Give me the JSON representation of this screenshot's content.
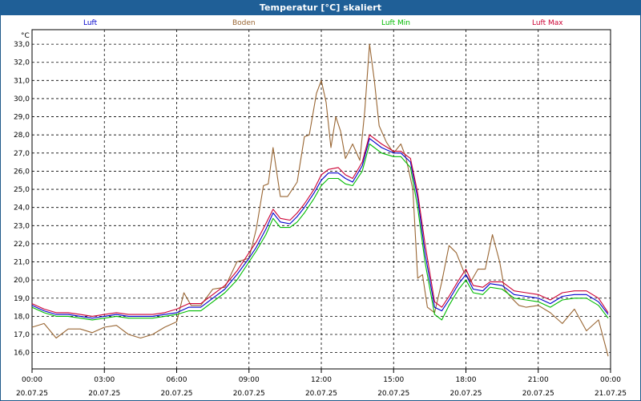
{
  "title": "Temperatur [°C] skaliert",
  "y_unit": "°C",
  "colors": {
    "titlebar": "#1f5f97",
    "Luft": "#0000cc",
    "Boden": "#996633",
    "Luft Min": "#00bb00",
    "Luft Max": "#cc0033"
  },
  "chart_data": {
    "type": "line",
    "title": "Temperatur [°C] skaliert",
    "ylabel": "°C",
    "ylim": [
      15.1,
      33.8
    ],
    "yticks": [
      "16,0",
      "17,0",
      "18,0",
      "19,0",
      "20,0",
      "21,0",
      "22,0",
      "23,0",
      "24,0",
      "25,0",
      "26,0",
      "27,0",
      "28,0",
      "29,0",
      "30,0",
      "31,0",
      "32,0",
      "33,0"
    ],
    "xlim": [
      0,
      24
    ],
    "xticks": [
      {
        "time": "00:00",
        "date": "20.07.25"
      },
      {
        "time": "03:00",
        "date": "20.07.25"
      },
      {
        "time": "06:00",
        "date": "20.07.25"
      },
      {
        "time": "09:00",
        "date": "20.07.25"
      },
      {
        "time": "12:00",
        "date": "20.07.25"
      },
      {
        "time": "15:00",
        "date": "20.07.25"
      },
      {
        "time": "18:00",
        "date": "20.07.25"
      },
      {
        "time": "21:00",
        "date": "20.07.25"
      },
      {
        "time": "00:00",
        "date": "21.07.25"
      }
    ],
    "grid": true,
    "legend": "top",
    "series": [
      {
        "name": "Luft",
        "x": [
          0,
          0.5,
          1,
          1.5,
          2,
          2.5,
          3,
          3.5,
          4,
          4.5,
          5,
          5.5,
          6,
          6.5,
          7,
          7.5,
          8,
          8.5,
          9,
          9.3,
          9.7,
          10,
          10.3,
          10.7,
          11,
          11.3,
          11.7,
          12,
          12.3,
          12.7,
          13,
          13.3,
          13.7,
          14,
          14.5,
          15,
          15.3,
          15.7,
          16,
          16.3,
          16.7,
          17,
          17.3,
          17.7,
          18,
          18.3,
          18.7,
          19,
          19.5,
          20,
          20.5,
          21,
          21.5,
          22,
          22.5,
          23,
          23.5,
          23.9
        ],
        "y": [
          18.6,
          18.3,
          18.1,
          18.1,
          18.0,
          17.9,
          18.0,
          18.1,
          18.0,
          18.0,
          18.0,
          18.1,
          18.2,
          18.5,
          18.5,
          19.0,
          19.5,
          20.3,
          21.2,
          21.8,
          22.8,
          23.7,
          23.2,
          23.1,
          23.5,
          24.0,
          24.8,
          25.5,
          25.9,
          25.9,
          25.6,
          25.4,
          26.3,
          27.8,
          27.3,
          27.0,
          27.0,
          26.5,
          24.5,
          21.5,
          18.5,
          18.3,
          18.9,
          19.8,
          20.3,
          19.5,
          19.4,
          19.8,
          19.7,
          19.2,
          19.1,
          19.0,
          18.7,
          19.1,
          19.2,
          19.2,
          18.8,
          18.1
        ]
      },
      {
        "name": "Boden",
        "x": [
          0,
          0.5,
          1,
          1.5,
          2,
          2.5,
          3,
          3.5,
          4,
          4.5,
          5,
          5.5,
          6,
          6.3,
          6.6,
          7,
          7.5,
          8,
          8.5,
          9,
          9.3,
          9.6,
          9.8,
          10,
          10.3,
          10.6,
          11,
          11.3,
          11.5,
          11.8,
          12,
          12.2,
          12.4,
          12.6,
          12.8,
          13,
          13.3,
          13.6,
          13.8,
          14,
          14.2,
          14.4,
          14.7,
          15,
          15.3,
          15.5,
          15.8,
          16,
          16.2,
          16.4,
          16.7,
          17,
          17.3,
          17.6,
          17.9,
          18.2,
          18.5,
          18.8,
          19.1,
          19.4,
          19.6,
          19.9,
          20.2,
          20.5,
          21,
          21.5,
          22,
          22.5,
          23,
          23.5,
          23.9
        ],
        "y": [
          17.4,
          17.6,
          16.8,
          17.3,
          17.3,
          17.1,
          17.4,
          17.5,
          17.0,
          16.8,
          17.0,
          17.4,
          17.7,
          19.3,
          18.6,
          18.6,
          19.5,
          19.6,
          21.0,
          21.2,
          22.8,
          25.2,
          25.3,
          27.3,
          24.6,
          24.6,
          25.4,
          27.9,
          28.0,
          30.3,
          31.0,
          29.8,
          27.3,
          29.0,
          28.2,
          26.7,
          27.5,
          26.6,
          29.3,
          33.0,
          31.0,
          28.5,
          27.6,
          27.0,
          27.5,
          26.8,
          25.0,
          20.1,
          20.3,
          18.5,
          18.2,
          19.9,
          21.9,
          21.5,
          20.5,
          19.9,
          20.6,
          20.6,
          22.5,
          21.0,
          19.5,
          19.0,
          18.6,
          18.5,
          18.6,
          18.2,
          17.6,
          18.4,
          17.2,
          17.8,
          15.8
        ]
      },
      {
        "name": "Luft Min",
        "x": [
          0,
          0.5,
          1,
          1.5,
          2,
          2.5,
          3,
          3.5,
          4,
          4.5,
          5,
          5.5,
          6,
          6.5,
          7,
          7.5,
          8,
          8.5,
          9,
          9.3,
          9.7,
          10,
          10.3,
          10.7,
          11,
          11.3,
          11.7,
          12,
          12.3,
          12.7,
          13,
          13.3,
          13.7,
          14,
          14.5,
          15,
          15.3,
          15.7,
          16,
          16.3,
          16.7,
          17,
          17.3,
          17.7,
          18,
          18.3,
          18.7,
          19,
          19.5,
          20,
          20.5,
          21,
          21.5,
          22,
          22.5,
          23,
          23.5,
          23.9
        ],
        "y": [
          18.5,
          18.2,
          18.0,
          18.0,
          17.9,
          17.8,
          17.9,
          18.0,
          17.9,
          17.9,
          17.9,
          18.0,
          18.1,
          18.3,
          18.3,
          18.8,
          19.3,
          20.0,
          21.0,
          21.6,
          22.5,
          23.4,
          22.9,
          22.9,
          23.2,
          23.7,
          24.5,
          25.2,
          25.6,
          25.6,
          25.3,
          25.2,
          26.0,
          27.5,
          27.0,
          26.8,
          26.8,
          26.2,
          24.0,
          21.0,
          18.1,
          17.8,
          18.6,
          19.5,
          20.0,
          19.3,
          19.2,
          19.6,
          19.5,
          19.0,
          18.9,
          18.8,
          18.5,
          18.9,
          19.0,
          19.0,
          18.6,
          17.9
        ]
      },
      {
        "name": "Luft Max",
        "x": [
          0,
          0.5,
          1,
          1.5,
          2,
          2.5,
          3,
          3.5,
          4,
          4.5,
          5,
          5.5,
          6,
          6.5,
          7,
          7.5,
          8,
          8.5,
          9,
          9.3,
          9.7,
          10,
          10.3,
          10.7,
          11,
          11.3,
          11.7,
          12,
          12.3,
          12.7,
          13,
          13.3,
          13.7,
          14,
          14.5,
          15,
          15.3,
          15.7,
          16,
          16.3,
          16.7,
          17,
          17.3,
          17.7,
          18,
          18.3,
          18.7,
          19,
          19.5,
          20,
          20.5,
          21,
          21.5,
          22,
          22.5,
          23,
          23.5,
          23.9
        ],
        "y": [
          18.7,
          18.4,
          18.2,
          18.2,
          18.1,
          18.0,
          18.1,
          18.2,
          18.1,
          18.1,
          18.1,
          18.2,
          18.4,
          18.7,
          18.7,
          19.2,
          19.7,
          20.5,
          21.5,
          22.1,
          23.1,
          23.9,
          23.4,
          23.3,
          23.7,
          24.2,
          25.0,
          25.8,
          26.1,
          26.2,
          25.8,
          25.6,
          26.5,
          28.0,
          27.5,
          27.1,
          27.1,
          26.7,
          24.8,
          22.0,
          18.8,
          18.5,
          19.1,
          20.0,
          20.6,
          19.7,
          19.6,
          19.9,
          19.9,
          19.4,
          19.3,
          19.2,
          18.9,
          19.3,
          19.4,
          19.4,
          19.0,
          18.2
        ]
      }
    ]
  }
}
